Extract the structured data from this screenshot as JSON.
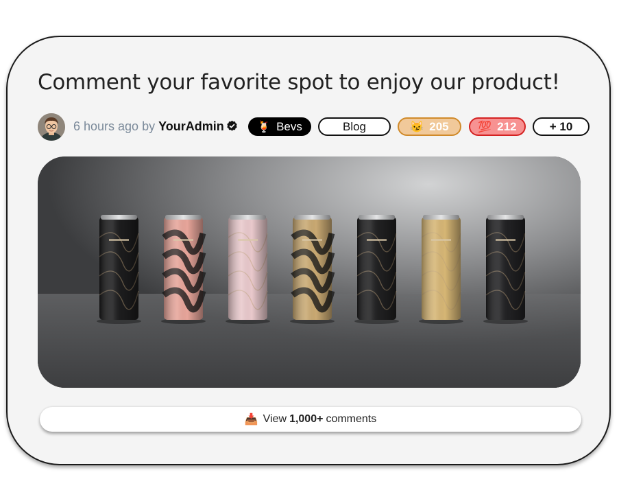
{
  "post": {
    "title": "Comment your favorite spot to enjoy our product!",
    "time_ago": "6 hours ago",
    "by_word": "by",
    "author": "YourAdmin",
    "author_verified": true
  },
  "tags": {
    "category": {
      "icon": "cocktail-icon",
      "emoji": "🍹",
      "label": "Bevs"
    },
    "type": {
      "label": "Blog"
    }
  },
  "reactions": [
    {
      "name": "smirk-cat",
      "emoji": "😼",
      "count": "205",
      "color": "#f1c99a",
      "border": "#d08a2a"
    },
    {
      "name": "hundred",
      "emoji": "💯",
      "count": "212",
      "color": "#f79292",
      "border": "#d42222"
    }
  ],
  "more_reactions": "+ 10",
  "image": {
    "subject": "seven-beverage-cans",
    "can_colors": [
      "#1b1b1c",
      "#e7a59a",
      "#e9c9cc",
      "#c9a972",
      "#1f1f20",
      "#d6b675",
      "#202022"
    ]
  },
  "comments": {
    "icon": "inbox-tray-icon",
    "prefix": "View",
    "count": "1,000+",
    "suffix": "comments"
  }
}
